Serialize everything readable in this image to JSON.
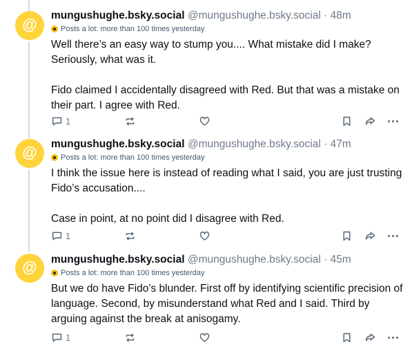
{
  "posts": [
    {
      "display_name": "mungushughe.bsky.social",
      "handle": "@mungushughe.bsky.social",
      "time": "48m",
      "avatar_glyph": "@",
      "label": "Posts a lot: more than 100 times yesterday",
      "paragraphs": [
        "Well there’s an easy way to stump you.... What mistake did I make? Seriously, what was it.",
        "Fido claimed I accidentally disagreed with Red. But that was a mistake on their part. I agree with Red."
      ],
      "reply_count": "1"
    },
    {
      "display_name": "mungushughe.bsky.social",
      "handle": "@mungushughe.bsky.social",
      "time": "47m",
      "avatar_glyph": "@",
      "label": "Posts a lot: more than 100 times yesterday",
      "paragraphs": [
        "I think the issue here is instead of reading what I said, you are just trusting Fido’s accusation....",
        "Case in point, at no point did I disagree with Red."
      ],
      "reply_count": "1"
    },
    {
      "display_name": "mungushughe.bsky.social",
      "handle": "@mungushughe.bsky.social",
      "time": "45m",
      "avatar_glyph": "@",
      "label": "Posts a lot: more than 100 times yesterday",
      "paragraphs": [
        "But we do have Fido’s blunder. First off by identifying scientific precision of language. Second, by misunderstand what Red and I said. Third by arguing against the break at anisogamy."
      ],
      "reply_count": "1"
    }
  ],
  "separator": "·",
  "colors": {
    "avatar": "#ffd43a",
    "thread_line": "#d4dbe2",
    "muted": "#6f7b88"
  }
}
